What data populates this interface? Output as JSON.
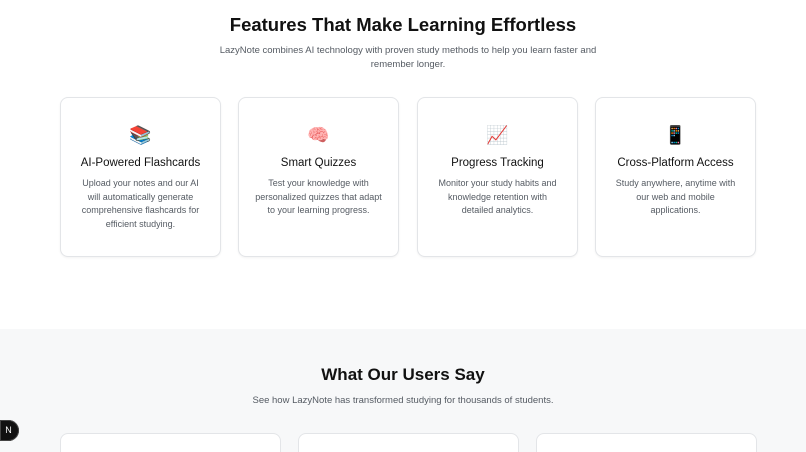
{
  "features": {
    "title": "Features That Make Learning Effortless",
    "subtitle": "LazyNote combines AI technology with proven study methods to help you learn faster and remember longer.",
    "cards": [
      {
        "icon": "📚",
        "icon_name": "books-icon",
        "title": "AI-Powered Flashcards",
        "description": "Upload your notes and our AI will automatically generate comprehensive flashcards for efficient studying."
      },
      {
        "icon": "🧠",
        "icon_name": "brain-icon",
        "title": "Smart Quizzes",
        "description": "Test your knowledge with personalized quizzes that adapt to your learning progress."
      },
      {
        "icon": "📈",
        "icon_name": "chart-increasing-icon",
        "title": "Progress Tracking",
        "description": "Monitor your study habits and knowledge retention with detailed analytics."
      },
      {
        "icon": "📱",
        "icon_name": "mobile-phone-icon",
        "title": "Cross-Platform Access",
        "description": "Study anywhere, anytime with our web and mobile applications."
      }
    ]
  },
  "testimonials": {
    "title": "What Our Users Say",
    "subtitle": "See how LazyNote has transformed studying for thousands of students."
  },
  "dev_badge": {
    "label": "N"
  }
}
